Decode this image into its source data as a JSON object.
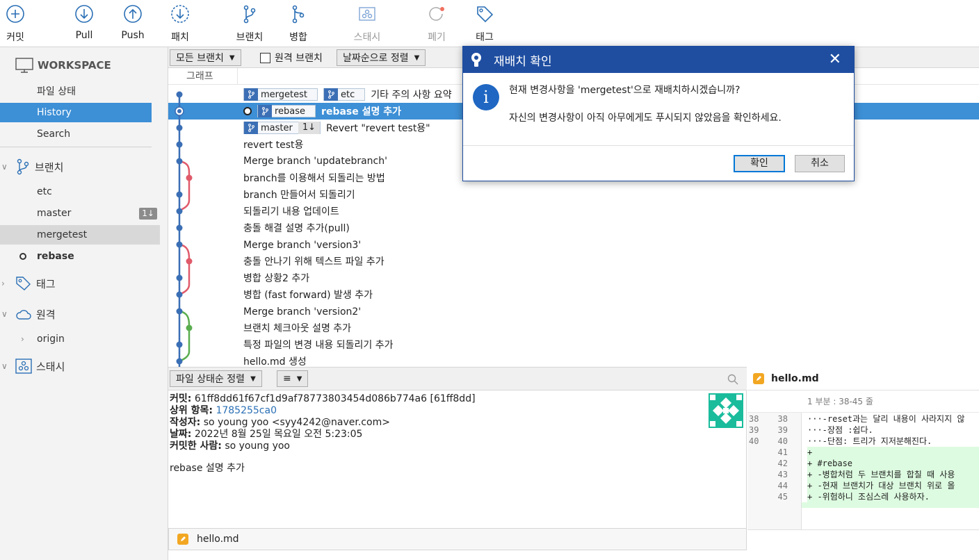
{
  "toolbar": {
    "commit": "커밋",
    "pull": "Pull",
    "push": "Push",
    "patch": "패치",
    "branch": "브랜치",
    "merge": "병합",
    "stash": "스태시",
    "discard": "폐기",
    "tag": "태그"
  },
  "sidebar": {
    "workspace": "WORKSPACE",
    "file_status": "파일 상태",
    "history": "History",
    "search": "Search",
    "branches_head": "브랜치",
    "branches": [
      {
        "label": "etc"
      },
      {
        "label": "master",
        "badge": "1↓"
      },
      {
        "label": "mergetest"
      },
      {
        "label": "rebase"
      }
    ],
    "tags_head": "태그",
    "remotes_head": "원격",
    "remote_origin": "origin",
    "stash_head": "스태시"
  },
  "filters": {
    "all_branches": "모든 브랜치",
    "remote_branches": "원격 브랜치",
    "sort": "날짜순으로 정렬"
  },
  "graph_header": "그래프",
  "commits": [
    {
      "refs": [
        {
          "name": "mergetest"
        },
        {
          "name": "etc"
        }
      ],
      "msg": "기타 주의 사항 요약"
    },
    {
      "refs": [
        {
          "name": "rebase"
        }
      ],
      "msg": "rebase 설명 추가",
      "head": true
    },
    {
      "refs": [
        {
          "name": "master",
          "count": "1↓"
        }
      ],
      "msg": "Revert \"revert test용\""
    },
    {
      "msg": "revert test용"
    },
    {
      "msg": "Merge branch 'updatebranch'"
    },
    {
      "msg": "branch를 이용해서 되돌리는 방법"
    },
    {
      "msg": "branch 만들어서 되돌리기"
    },
    {
      "msg": "되돌리기 내용 업데이트"
    },
    {
      "msg": "충돌 해결 설명 추가(pull)"
    },
    {
      "msg": "Merge branch 'version3'"
    },
    {
      "msg": "충돌 안나기 위해 텍스트 파일 추가"
    },
    {
      "msg": "병합 상황2 추가"
    },
    {
      "msg": "병합 (fast forward) 발생 추가"
    },
    {
      "msg": "Merge branch 'version2'"
    },
    {
      "msg": "브랜치 체크아웃 설명 추가"
    },
    {
      "msg": "특정 파일의 변경 내용 되돌리기 추가"
    },
    {
      "msg": "hello.md 생성"
    }
  ],
  "bottom": {
    "sort_files": "파일 상태순 정렬",
    "list_icon": "≡",
    "commit_label": "커밋:",
    "commit_value": "61ff8dd61f67cf1d9af78773803454d086b774a6 [61ff8dd]",
    "parent_label": "상위 항목:",
    "parent_value": "1785255ca0",
    "author_label": "작성자:",
    "author_value": "so young yoo <syy4242@naver.com>",
    "date_label": "날짜:",
    "date_value": "2022년 8월 25일 목요일 오전 5:23:05",
    "committer_label": "커밋한 사람:",
    "committer_value": "so young yoo",
    "message": "rebase 설명 추가",
    "file": "hello.md"
  },
  "diff": {
    "file": "hello.md",
    "hunk": "1 부분 : 38-45 줄",
    "lines": [
      {
        "o": "38",
        "n": "38",
        "t": "···-reset과는 달리 내용이 사라지지 않",
        "add": false
      },
      {
        "o": "39",
        "n": "39",
        "t": "···-장점 :쉽다.",
        "add": false
      },
      {
        "o": "40",
        "n": "40",
        "t": "···-단점: 트리가 지저분해진다.",
        "add": false
      },
      {
        "o": "",
        "n": "41",
        "t": "+",
        "add": true
      },
      {
        "o": "",
        "n": "42",
        "t": "+ #rebase",
        "add": true
      },
      {
        "o": "",
        "n": "43",
        "t": "+ -병합처럼 두 브랜치를 합칠 때 사용",
        "add": true
      },
      {
        "o": "",
        "n": "44",
        "t": "+ -현재 브랜치가 대상 브랜치 위로 올",
        "add": true
      },
      {
        "o": "",
        "n": "45",
        "t": "+ -위험하니 조심스레 사용하자.",
        "add": true
      }
    ]
  },
  "dialog": {
    "title": "재배치 확인",
    "close": "✕",
    "info": "i",
    "line1": "현재 변경사항을 'mergetest'으로 재배치하시겠습니까?",
    "line2": "자신의 변경사항이 아직 아무에게도 푸시되지 않았음을 확인하세요.",
    "ok": "확인",
    "cancel": "취소"
  },
  "colors": {
    "accent": "#3d8fd6",
    "dialog_title": "#1f4ea1",
    "graph_blue": "#3b6fb5",
    "graph_red": "#e05a6a",
    "graph_green": "#5aad4f",
    "add_bg": "#ddfbe0"
  }
}
